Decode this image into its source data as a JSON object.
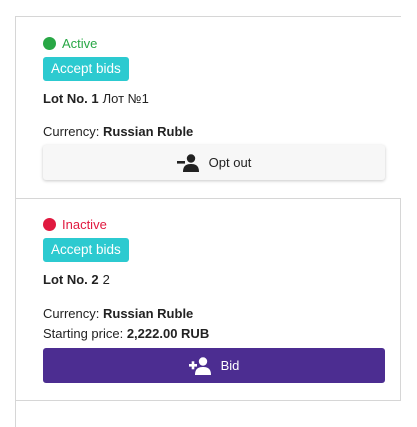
{
  "colors": {
    "active": "#28a745",
    "inactive": "#e0193f",
    "badge": "#2ccad0",
    "bid_button": "#4c2d91"
  },
  "lots": [
    {
      "status": "Active",
      "badge": "Accept bids",
      "title_bold": "Lot No. 1",
      "title_sub": "Лот №1",
      "currency_label": "Currency:",
      "currency_value": "Russian Ruble",
      "button_label": "Opt out",
      "button_icon": "user-minus-icon"
    },
    {
      "status": "Inactive",
      "badge": "Accept bids",
      "title_bold": "Lot No. 2",
      "title_sub": "2",
      "currency_label": "Currency:",
      "currency_value": "Russian Ruble",
      "price_label": "Starting price:",
      "price_value": "2,222.00 RUB",
      "button_label": "Bid",
      "button_icon": "user-plus-icon"
    }
  ]
}
